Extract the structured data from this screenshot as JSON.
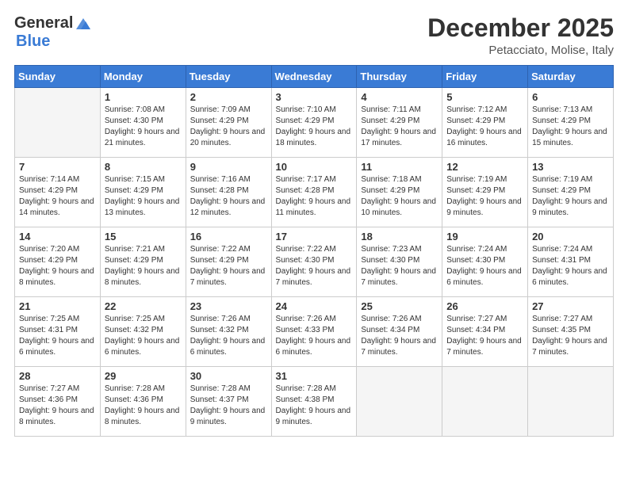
{
  "logo": {
    "general": "General",
    "blue": "Blue"
  },
  "title": "December 2025",
  "location": "Petacciato, Molise, Italy",
  "days_of_week": [
    "Sunday",
    "Monday",
    "Tuesday",
    "Wednesday",
    "Thursday",
    "Friday",
    "Saturday"
  ],
  "weeks": [
    [
      {
        "day": "",
        "sunrise": "",
        "sunset": "",
        "daylight": "",
        "empty": true
      },
      {
        "day": "1",
        "sunrise": "Sunrise: 7:08 AM",
        "sunset": "Sunset: 4:30 PM",
        "daylight": "Daylight: 9 hours and 21 minutes."
      },
      {
        "day": "2",
        "sunrise": "Sunrise: 7:09 AM",
        "sunset": "Sunset: 4:29 PM",
        "daylight": "Daylight: 9 hours and 20 minutes."
      },
      {
        "day": "3",
        "sunrise": "Sunrise: 7:10 AM",
        "sunset": "Sunset: 4:29 PM",
        "daylight": "Daylight: 9 hours and 18 minutes."
      },
      {
        "day": "4",
        "sunrise": "Sunrise: 7:11 AM",
        "sunset": "Sunset: 4:29 PM",
        "daylight": "Daylight: 9 hours and 17 minutes."
      },
      {
        "day": "5",
        "sunrise": "Sunrise: 7:12 AM",
        "sunset": "Sunset: 4:29 PM",
        "daylight": "Daylight: 9 hours and 16 minutes."
      },
      {
        "day": "6",
        "sunrise": "Sunrise: 7:13 AM",
        "sunset": "Sunset: 4:29 PM",
        "daylight": "Daylight: 9 hours and 15 minutes."
      }
    ],
    [
      {
        "day": "7",
        "sunrise": "Sunrise: 7:14 AM",
        "sunset": "Sunset: 4:29 PM",
        "daylight": "Daylight: 9 hours and 14 minutes."
      },
      {
        "day": "8",
        "sunrise": "Sunrise: 7:15 AM",
        "sunset": "Sunset: 4:29 PM",
        "daylight": "Daylight: 9 hours and 13 minutes."
      },
      {
        "day": "9",
        "sunrise": "Sunrise: 7:16 AM",
        "sunset": "Sunset: 4:28 PM",
        "daylight": "Daylight: 9 hours and 12 minutes."
      },
      {
        "day": "10",
        "sunrise": "Sunrise: 7:17 AM",
        "sunset": "Sunset: 4:28 PM",
        "daylight": "Daylight: 9 hours and 11 minutes."
      },
      {
        "day": "11",
        "sunrise": "Sunrise: 7:18 AM",
        "sunset": "Sunset: 4:29 PM",
        "daylight": "Daylight: 9 hours and 10 minutes."
      },
      {
        "day": "12",
        "sunrise": "Sunrise: 7:19 AM",
        "sunset": "Sunset: 4:29 PM",
        "daylight": "Daylight: 9 hours and 9 minutes."
      },
      {
        "day": "13",
        "sunrise": "Sunrise: 7:19 AM",
        "sunset": "Sunset: 4:29 PM",
        "daylight": "Daylight: 9 hours and 9 minutes."
      }
    ],
    [
      {
        "day": "14",
        "sunrise": "Sunrise: 7:20 AM",
        "sunset": "Sunset: 4:29 PM",
        "daylight": "Daylight: 9 hours and 8 minutes."
      },
      {
        "day": "15",
        "sunrise": "Sunrise: 7:21 AM",
        "sunset": "Sunset: 4:29 PM",
        "daylight": "Daylight: 9 hours and 8 minutes."
      },
      {
        "day": "16",
        "sunrise": "Sunrise: 7:22 AM",
        "sunset": "Sunset: 4:29 PM",
        "daylight": "Daylight: 9 hours and 7 minutes."
      },
      {
        "day": "17",
        "sunrise": "Sunrise: 7:22 AM",
        "sunset": "Sunset: 4:30 PM",
        "daylight": "Daylight: 9 hours and 7 minutes."
      },
      {
        "day": "18",
        "sunrise": "Sunrise: 7:23 AM",
        "sunset": "Sunset: 4:30 PM",
        "daylight": "Daylight: 9 hours and 7 minutes."
      },
      {
        "day": "19",
        "sunrise": "Sunrise: 7:24 AM",
        "sunset": "Sunset: 4:30 PM",
        "daylight": "Daylight: 9 hours and 6 minutes."
      },
      {
        "day": "20",
        "sunrise": "Sunrise: 7:24 AM",
        "sunset": "Sunset: 4:31 PM",
        "daylight": "Daylight: 9 hours and 6 minutes."
      }
    ],
    [
      {
        "day": "21",
        "sunrise": "Sunrise: 7:25 AM",
        "sunset": "Sunset: 4:31 PM",
        "daylight": "Daylight: 9 hours and 6 minutes."
      },
      {
        "day": "22",
        "sunrise": "Sunrise: 7:25 AM",
        "sunset": "Sunset: 4:32 PM",
        "daylight": "Daylight: 9 hours and 6 minutes."
      },
      {
        "day": "23",
        "sunrise": "Sunrise: 7:26 AM",
        "sunset": "Sunset: 4:32 PM",
        "daylight": "Daylight: 9 hours and 6 minutes."
      },
      {
        "day": "24",
        "sunrise": "Sunrise: 7:26 AM",
        "sunset": "Sunset: 4:33 PM",
        "daylight": "Daylight: 9 hours and 6 minutes."
      },
      {
        "day": "25",
        "sunrise": "Sunrise: 7:26 AM",
        "sunset": "Sunset: 4:34 PM",
        "daylight": "Daylight: 9 hours and 7 minutes."
      },
      {
        "day": "26",
        "sunrise": "Sunrise: 7:27 AM",
        "sunset": "Sunset: 4:34 PM",
        "daylight": "Daylight: 9 hours and 7 minutes."
      },
      {
        "day": "27",
        "sunrise": "Sunrise: 7:27 AM",
        "sunset": "Sunset: 4:35 PM",
        "daylight": "Daylight: 9 hours and 7 minutes."
      }
    ],
    [
      {
        "day": "28",
        "sunrise": "Sunrise: 7:27 AM",
        "sunset": "Sunset: 4:36 PM",
        "daylight": "Daylight: 9 hours and 8 minutes."
      },
      {
        "day": "29",
        "sunrise": "Sunrise: 7:28 AM",
        "sunset": "Sunset: 4:36 PM",
        "daylight": "Daylight: 9 hours and 8 minutes."
      },
      {
        "day": "30",
        "sunrise": "Sunrise: 7:28 AM",
        "sunset": "Sunset: 4:37 PM",
        "daylight": "Daylight: 9 hours and 9 minutes."
      },
      {
        "day": "31",
        "sunrise": "Sunrise: 7:28 AM",
        "sunset": "Sunset: 4:38 PM",
        "daylight": "Daylight: 9 hours and 9 minutes."
      },
      {
        "day": "",
        "sunrise": "",
        "sunset": "",
        "daylight": "",
        "empty": true
      },
      {
        "day": "",
        "sunrise": "",
        "sunset": "",
        "daylight": "",
        "empty": true
      },
      {
        "day": "",
        "sunrise": "",
        "sunset": "",
        "daylight": "",
        "empty": true
      }
    ]
  ]
}
